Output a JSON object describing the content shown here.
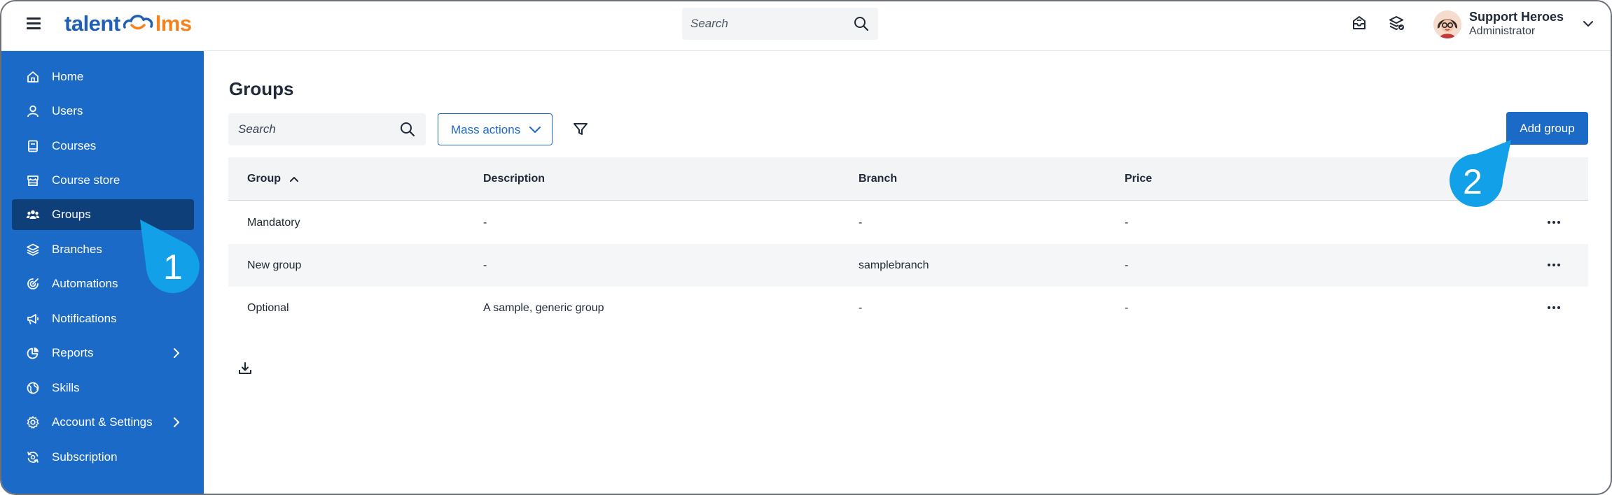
{
  "app": {
    "logo_part1": "talent",
    "logo_part2": "lms"
  },
  "topbar": {
    "search_placeholder": "Search",
    "user_name": "Support Heroes",
    "user_role": "Administrator"
  },
  "sidebar": {
    "items": [
      {
        "label": "Home",
        "icon": "home-icon"
      },
      {
        "label": "Users",
        "icon": "user-icon"
      },
      {
        "label": "Courses",
        "icon": "book-icon"
      },
      {
        "label": "Course store",
        "icon": "store-icon"
      },
      {
        "label": "Groups",
        "icon": "groups-icon",
        "active": true
      },
      {
        "label": "Branches",
        "icon": "layers-icon"
      },
      {
        "label": "Automations",
        "icon": "automation-icon"
      },
      {
        "label": "Notifications",
        "icon": "megaphone-icon"
      },
      {
        "label": "Reports",
        "icon": "pie-chart-icon",
        "expandable": true
      },
      {
        "label": "Skills",
        "icon": "globe-icon"
      },
      {
        "label": "Account & Settings",
        "icon": "gear-icon",
        "expandable": true
      },
      {
        "label": "Subscription",
        "icon": "subscription-icon"
      }
    ]
  },
  "main": {
    "title": "Groups",
    "search_placeholder": "Search",
    "mass_actions_label": "Mass actions",
    "add_group_label": "Add group"
  },
  "table": {
    "columns": [
      "Group",
      "Description",
      "Branch",
      "Price"
    ],
    "rows": [
      {
        "group": "Mandatory",
        "description": "-",
        "branch": "-",
        "price": "-"
      },
      {
        "group": "New group",
        "description": "-",
        "branch": "samplebranch",
        "price": "-"
      },
      {
        "group": "Optional",
        "description": "A sample, generic group",
        "branch": "-",
        "price": "-"
      }
    ]
  },
  "callouts": {
    "first": "1",
    "second": "2"
  },
  "colors": {
    "sidebar_bg": "#1c6ac7",
    "sidebar_active": "#0f3f78",
    "accent": "#1c6ac7",
    "callout": "#12a0e8",
    "logo_orange": "#f4821f"
  }
}
